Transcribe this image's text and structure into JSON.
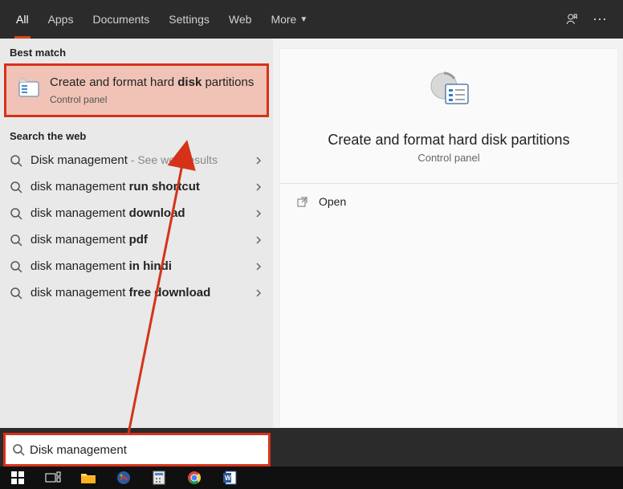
{
  "tabs": {
    "all": "All",
    "apps": "Apps",
    "documents": "Documents",
    "settings": "Settings",
    "web": "Web",
    "more": "More"
  },
  "sections": {
    "best_match": "Best match",
    "search_web": "Search the web"
  },
  "best_match_result": {
    "title_prefix": "Create and format hard ",
    "title_bold": "disk",
    "title_suffix": " partitions",
    "subtitle": "Control panel"
  },
  "web_results": [
    {
      "prefix": "Disk management",
      "bold": "",
      "suffix": "",
      "trail": " - See web results"
    },
    {
      "prefix": "disk management ",
      "bold": "run shortcut",
      "suffix": "",
      "trail": ""
    },
    {
      "prefix": "disk management ",
      "bold": "download",
      "suffix": "",
      "trail": ""
    },
    {
      "prefix": "disk management ",
      "bold": "pdf",
      "suffix": "",
      "trail": ""
    },
    {
      "prefix": "disk management ",
      "bold": "in hindi",
      "suffix": "",
      "trail": ""
    },
    {
      "prefix": "disk management ",
      "bold": "free download",
      "suffix": "",
      "trail": ""
    }
  ],
  "detail": {
    "title": "Create and format hard disk partitions",
    "subtitle": "Control panel",
    "open": "Open"
  },
  "search": {
    "value": "Disk management"
  }
}
